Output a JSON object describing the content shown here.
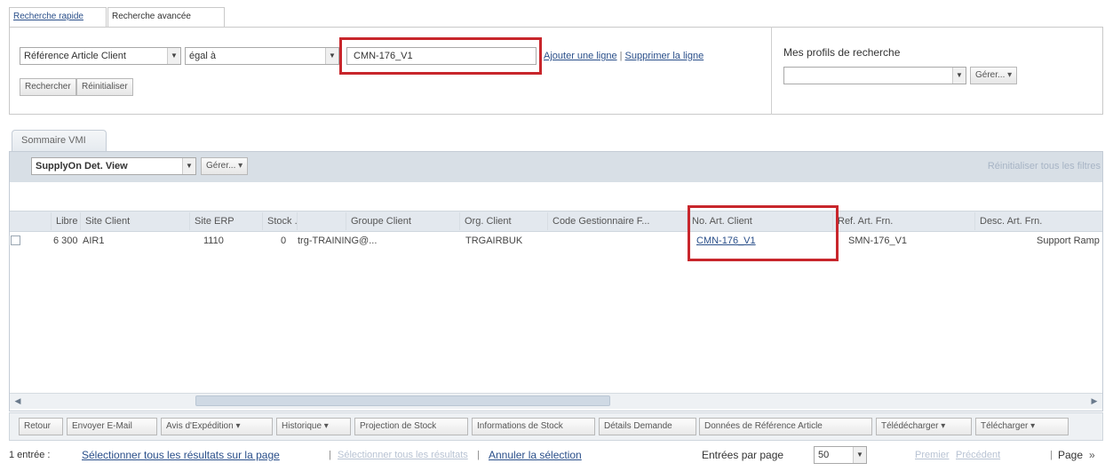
{
  "tabs": {
    "quick": "Recherche rapide",
    "advanced": "Recherche avancée"
  },
  "search": {
    "field": "Référence Article Client",
    "operator": "égal à",
    "value": "CMN-176_V1",
    "add_line": "Ajouter une ligne",
    "sep": "|",
    "remove_line": "Supprimer la ligne",
    "search_btn": "Rechercher",
    "reset_btn": "Réinitialiser"
  },
  "profiles": {
    "title": "Mes profils de recherche",
    "value": "",
    "manage": "Gérer..."
  },
  "grid": {
    "tab": "Sommaire VMI",
    "view": "SupplyOn Det. View",
    "manage": "Gérer...",
    "reset_filters": "Réinitialiser tous les filtres",
    "headers": [
      "Libre",
      "Site Client",
      "Site ERP",
      "Stock ...",
      "Groupe Client",
      "Org. Client",
      "Code Gestionnaire F...",
      "No. Art. Client",
      "Ref. Art. Frn.",
      "Desc. Art. Frn."
    ],
    "row": [
      "6 300",
      "AIR1",
      "1110",
      "0",
      "trg-TRAINING@...",
      "TRGAIRBUK",
      "",
      "CMN-176_V1",
      "SMN-176_V1",
      "Support Ramp"
    ]
  },
  "toolbar": {
    "buttons": [
      "Retour",
      "Envoyer E-Mail",
      "Avis d'Expédition",
      "Historique",
      "Projection de Stock",
      "Informations de Stock",
      "Détails Demande",
      "Données de Référence Article",
      "Télédécharger",
      "Télécharger"
    ],
    "dropdown_flags": [
      false,
      false,
      true,
      true,
      false,
      false,
      false,
      false,
      true,
      true
    ]
  },
  "footer": {
    "count": "1 entrée :",
    "select_page": "Sélectionner tous les résultats sur la page",
    "select_all": "Sélectionner tous les résultats",
    "cancel_selection": "Annuler la sélection",
    "per_page_label": "Entrées par page",
    "per_page": "50",
    "first": "Premier",
    "previous": "Précédent",
    "page": "Page",
    "next": "»"
  },
  "colors": {
    "highlight": "#c8262c",
    "link": "#2a4f8a",
    "grid_header": "#e3e8ee"
  },
  "icons": [
    "chevron-down-icon",
    "checkbox-icon",
    "scroll-left-icon",
    "scroll-right-icon"
  ]
}
